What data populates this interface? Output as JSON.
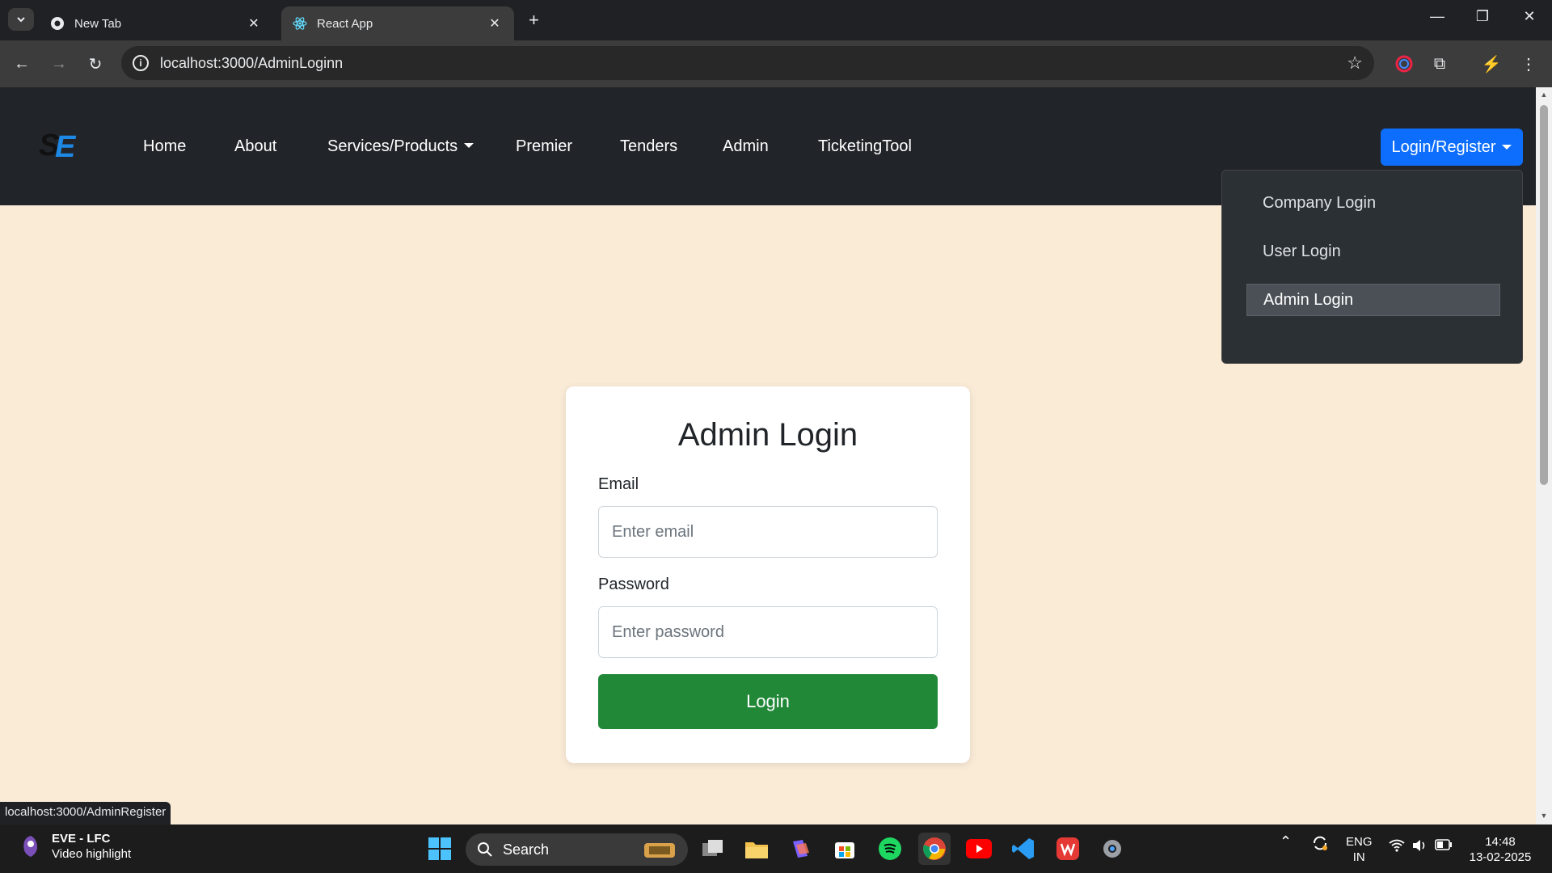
{
  "browser": {
    "tabs": [
      {
        "title": "New Tab"
      },
      {
        "title": "React App"
      }
    ],
    "url": "localhost:3000/AdminLoginn"
  },
  "navbar": {
    "links": [
      "Home",
      "About",
      "Services/Products",
      "Premier",
      "Tenders",
      "Admin",
      "TicketingTool"
    ],
    "login_register": "Login/Register",
    "dropdown": [
      "Company Login",
      "User Login",
      "Admin Login"
    ]
  },
  "form": {
    "title": "Admin Login",
    "email_label": "Email",
    "email_placeholder": "Enter email",
    "password_label": "Password",
    "password_placeholder": "Enter password",
    "submit": "Login"
  },
  "status_url": "localhost:3000/AdminRegister",
  "taskbar": {
    "news_title": "EVE - LFC",
    "news_sub": "Video highlight",
    "search": "Search",
    "lang": "ENG",
    "region": "IN",
    "time": "14:48",
    "date": "13-02-2025"
  },
  "colors": {
    "page_bg": "#faebd7",
    "navbar_bg": "#212529",
    "primary": "#0d6efd",
    "success": "#218838"
  }
}
